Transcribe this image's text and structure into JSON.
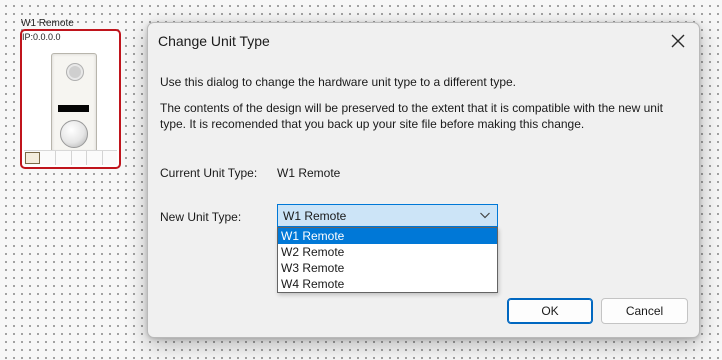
{
  "canvas": {
    "device_name": "W1 Remote",
    "device_ip": "IP:0.0.0.0"
  },
  "dialog": {
    "title": "Change Unit Type",
    "close_icon": "close-icon",
    "paragraph1": "Use this dialog to change the hardware unit type to a different type.",
    "paragraph2": "The contents of the design will be preserved to the extent that it is compatible with the new unit type.  It is recomended that you back up your site file before making this change.",
    "current_unit_label": "Current Unit Type:",
    "current_unit_value": "W1 Remote",
    "new_unit_label": "New Unit Type:",
    "new_unit_selected": "W1 Remote",
    "new_unit_options": [
      "W1 Remote",
      "W2 Remote",
      "W3 Remote",
      "W4 Remote"
    ],
    "ok_label": "OK",
    "cancel_label": "Cancel"
  },
  "colors": {
    "device_border": "#c0141c",
    "selection": "#0078d7",
    "select_background": "#cce4f7",
    "dialog_background": "#f0f0f0"
  }
}
